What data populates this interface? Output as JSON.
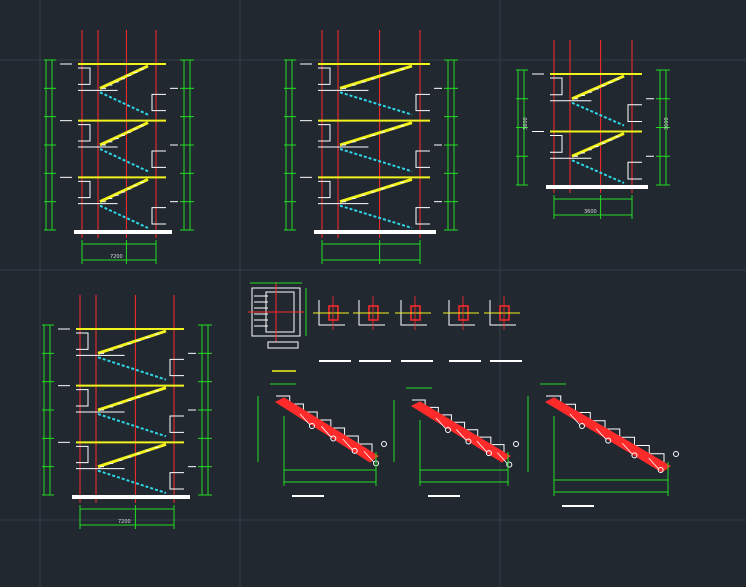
{
  "colors": {
    "background": "#212830",
    "grid": "#323c48",
    "red": "#ff2a2a",
    "green": "#22dd22",
    "yellow": "#f2f21c",
    "cyan": "#2fd6e6",
    "white": "#ffffff",
    "dim_white": "#d8d8d8"
  },
  "drawing": {
    "dim_labels": {
      "section_1": "7200",
      "section_2": "",
      "section_3_left": "3600",
      "section_3_right": "3600",
      "section_4": "7200"
    }
  }
}
